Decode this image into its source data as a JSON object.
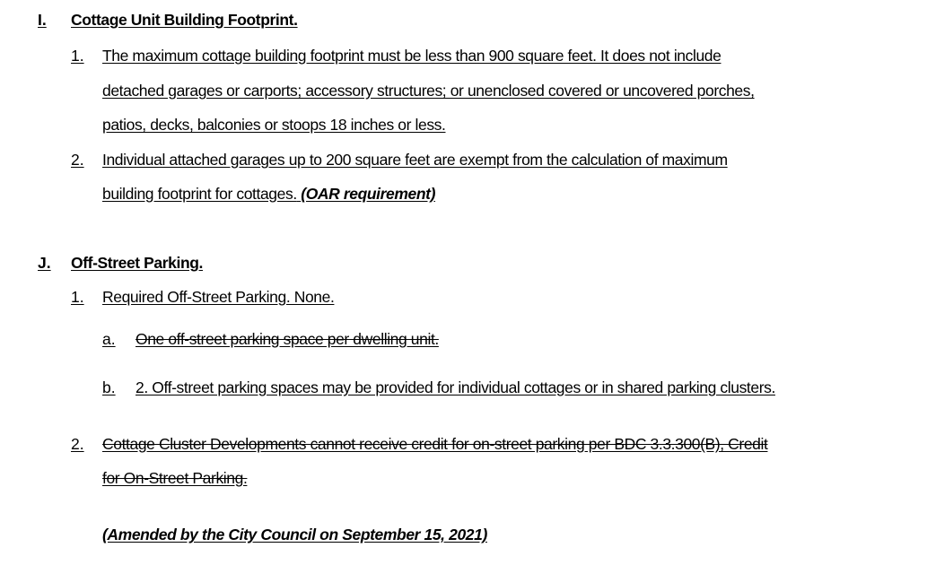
{
  "sectionI": {
    "letter": "I.",
    "title": "Cottage Unit Building Footprint.",
    "items": [
      {
        "num": "1.",
        "lines": [
          "The maximum cottage building footprint must be less than 900 square feet. It does not include",
          "detached garages or carports; accessory structures; or unenclosed covered or uncovered porches,",
          "patios, decks, balconies or stoops 18 inches or less."
        ]
      },
      {
        "num": "2.",
        "lines": [
          "Individual attached garages up to 200 square feet are exempt from the calculation of maximum"
        ],
        "last_line": "building footprint for cottages.",
        "note": "(OAR requirement)"
      }
    ]
  },
  "sectionJ": {
    "letter": "J.",
    "title": "Off-Street Parking.",
    "item1": {
      "num": "1.",
      "text": "Required Off-Street Parking. None.",
      "sub_a": {
        "letter": "a.",
        "text": "One off-street parking space per dwelling unit."
      },
      "sub_b": {
        "letter": "b.",
        "text": "2. Off-street parking spaces may be provided for individual cottages or in shared parking clusters."
      }
    },
    "item2": {
      "num": "2.",
      "lines": [
        "Cottage Cluster Developments cannot receive credit for on-street parking per BDC 3.3.300(B), Credit",
        "for On-Street Parking."
      ]
    }
  },
  "amendment": "(Amended by the City Council on September 15, 2021)"
}
